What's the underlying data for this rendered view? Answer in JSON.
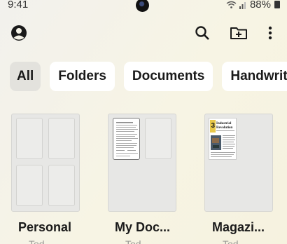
{
  "status_bar": {
    "time": "9:41",
    "battery": "88%",
    "icons": [
      "wifi-icon",
      "signal-icon",
      "battery-icon"
    ]
  },
  "app_bar": {
    "icons": [
      "account-icon",
      "search-icon",
      "new-folder-icon",
      "more-vert-icon"
    ]
  },
  "filters": [
    {
      "label": "All",
      "selected": true
    },
    {
      "label": "Folders",
      "selected": false
    },
    {
      "label": "Documents",
      "selected": false
    },
    {
      "label": "Handwrit",
      "selected": false
    }
  ],
  "items": [
    {
      "name": "Personal",
      "sub": "Tod"
    },
    {
      "name": "My Doc...",
      "sub": "Tod"
    },
    {
      "name": "Magazi...",
      "sub": "Tod"
    }
  ],
  "thumbnails": {
    "magazine_title": "Industrial Revolution",
    "magazine_number": "3"
  },
  "colors": {
    "chip_selected": "#e3e2dd",
    "chip_default": "#ffffff",
    "tile": "#e7e7e5",
    "background": "#f4f2e6"
  }
}
